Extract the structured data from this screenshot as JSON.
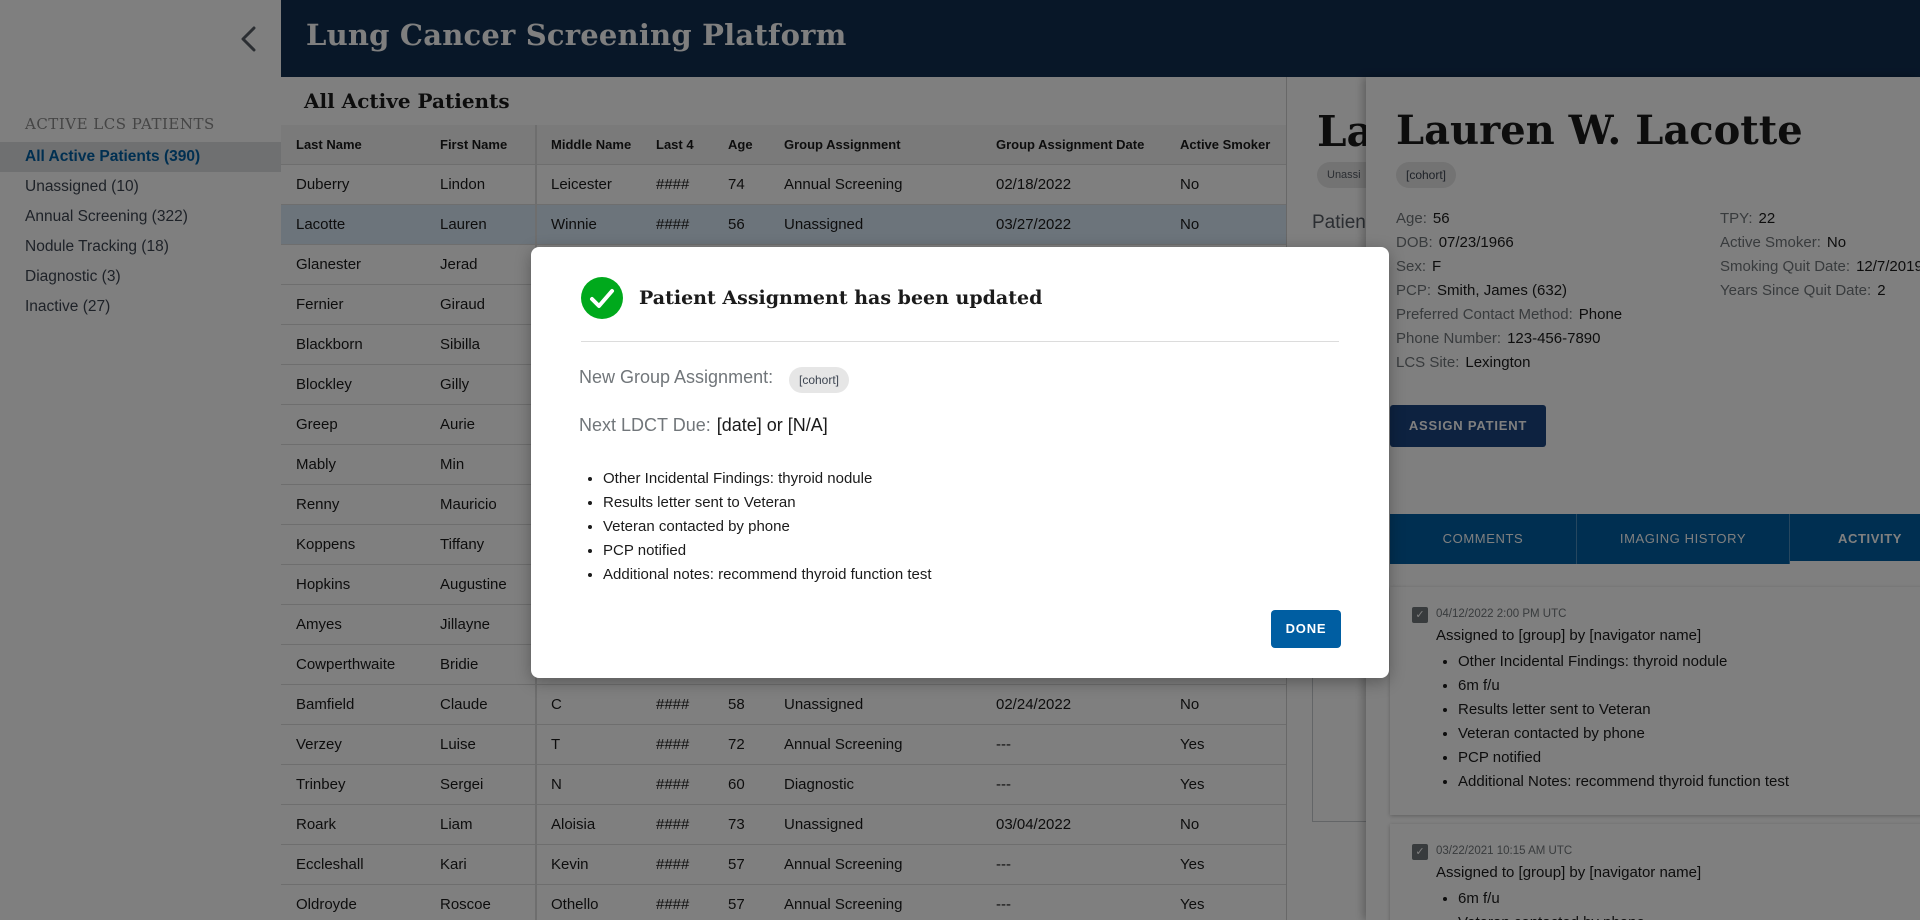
{
  "header": {
    "title": "Lung Cancer Screening Platform"
  },
  "sidebar": {
    "section_title": "ACTIVE LCS PATIENTS",
    "items": [
      {
        "label": "All Active Patients (390)"
      },
      {
        "label": "Unassigned (10)"
      },
      {
        "label": "Annual Screening (322)"
      },
      {
        "label": "Nodule Tracking (18)"
      },
      {
        "label": "Diagnostic (3)"
      },
      {
        "label": "Inactive (27)"
      }
    ]
  },
  "main": {
    "title": "All Active Patients",
    "columns": [
      "Last Name",
      "First Name",
      "Middle Name",
      "Last 4",
      "Age",
      "Group Assignment",
      "Group Assignment Date",
      "Active Smoker"
    ],
    "rows": [
      [
        "Duberry",
        "Lindon",
        "Leicester",
        "####",
        "74",
        "Annual Screening",
        "02/18/2022",
        "No"
      ],
      [
        "Lacotte",
        "Lauren",
        "Winnie",
        "####",
        "56",
        "Unassigned",
        "03/27/2022",
        "No"
      ],
      [
        "Glanester",
        "Jerad",
        "",
        "",
        "",
        "",
        "",
        ""
      ],
      [
        "Fernier",
        "Giraud",
        "",
        "",
        "",
        "",
        "",
        ""
      ],
      [
        "Blackborn",
        "Sibilla",
        "",
        "",
        "",
        "",
        "",
        ""
      ],
      [
        "Blockley",
        "Gilly",
        "",
        "",
        "",
        "",
        "",
        ""
      ],
      [
        "Greep",
        "Aurie",
        "",
        "",
        "",
        "",
        "",
        ""
      ],
      [
        "Mably",
        "Min",
        "",
        "",
        "",
        "",
        "",
        ""
      ],
      [
        "Renny",
        "Mauricio",
        "",
        "",
        "",
        "",
        "",
        ""
      ],
      [
        "Koppens",
        "Tiffany",
        "",
        "",
        "",
        "",
        "",
        ""
      ],
      [
        "Hopkins",
        "Augustine",
        "",
        "",
        "",
        "",
        "",
        ""
      ],
      [
        "Amyes",
        "Jillayne",
        "",
        "",
        "",
        "",
        "",
        ""
      ],
      [
        "Cowperthwaite",
        "Bridie",
        "",
        "",
        "",
        "",
        "",
        ""
      ],
      [
        "Bamfield",
        "Claude",
        "C",
        "####",
        "58",
        "Unassigned",
        "02/24/2022",
        "No"
      ],
      [
        "Verzey",
        "Luise",
        "T",
        "####",
        "72",
        "Annual Screening",
        "---",
        "Yes"
      ],
      [
        "Trinbey",
        "Sergei",
        "N",
        "####",
        "60",
        "Diagnostic",
        "---",
        "Yes"
      ],
      [
        "Roark",
        "Liam",
        "Aloisia",
        "####",
        "73",
        "Unassigned",
        "03/04/2022",
        "No"
      ],
      [
        "Eccleshall",
        "Kari",
        "Kevin",
        "####",
        "57",
        "Annual Screening",
        "---",
        "Yes"
      ],
      [
        "Oldroyde",
        "Roscoe",
        "Othello",
        "####",
        "57",
        "Annual Screening",
        "---",
        "Yes"
      ]
    ]
  },
  "panel_behind": {
    "name": "Lau",
    "chip": "Unassi",
    "patient": "Patient"
  },
  "panel": {
    "name": "Lauren W. Lacotte",
    "cohort": "[cohort]",
    "info_left": [
      {
        "k": "Age:",
        "v": "56"
      },
      {
        "k": "DOB:",
        "v": "07/23/1966"
      },
      {
        "k": "Sex:",
        "v": "F"
      },
      {
        "k": "PCP:",
        "v": "Smith, James (632)"
      },
      {
        "k": "Preferred Contact Method:",
        "v": "Phone"
      },
      {
        "k": "Phone Number:",
        "v": "123-456-7890"
      },
      {
        "k": "LCS Site:",
        "v": "Lexington"
      }
    ],
    "info_right": [
      {
        "k": "TPY:",
        "v": "22"
      },
      {
        "k": "Active Smoker:",
        "v": "No"
      },
      {
        "k": "Smoking Quit Date:",
        "v": "12/7/2019"
      },
      {
        "k": "Years Since Quit Date:",
        "v": "2"
      }
    ],
    "assign_label": "ASSIGN PATIENT",
    "tabs": [
      "COMMENTS",
      "IMAGING HISTORY",
      "ACTIVITY"
    ],
    "cards": [
      {
        "ts": "04/12/2022 2:00 PM UTC",
        "line": "Assigned to [group] by [navigator name]",
        "items": [
          "Other Incidental Findings: thyroid nodule",
          "6m f/u",
          "Results letter sent to Veteran",
          "Veteran contacted by phone",
          "PCP notified",
          "Additional Notes: recommend thyroid function test"
        ]
      },
      {
        "ts": "03/22/2021 10:15 AM UTC",
        "line": "Assigned to [group] by [navigator name]",
        "items": [
          "6m f/u",
          "Veteran contacted by phone"
        ]
      }
    ]
  },
  "modal": {
    "title": "Patient Assignment has been updated",
    "new_group_label": "New Group Assignment:",
    "new_group_value": "[cohort]",
    "next_ldct_label": "Next LDCT Due:",
    "next_ldct_value": "[date] or [N/A]",
    "items": [
      "Other Incidental Findings: thyroid nodule",
      "Results letter sent to Veteran",
      "Veteran contacted by phone",
      "PCP notified",
      "Additional notes: recommend thyroid function test"
    ],
    "done_label": "DONE"
  },
  "colors": {
    "header": "#112e51",
    "accent": "#005ea2",
    "success": "#00a91c",
    "assign_button": "#1a4480"
  }
}
